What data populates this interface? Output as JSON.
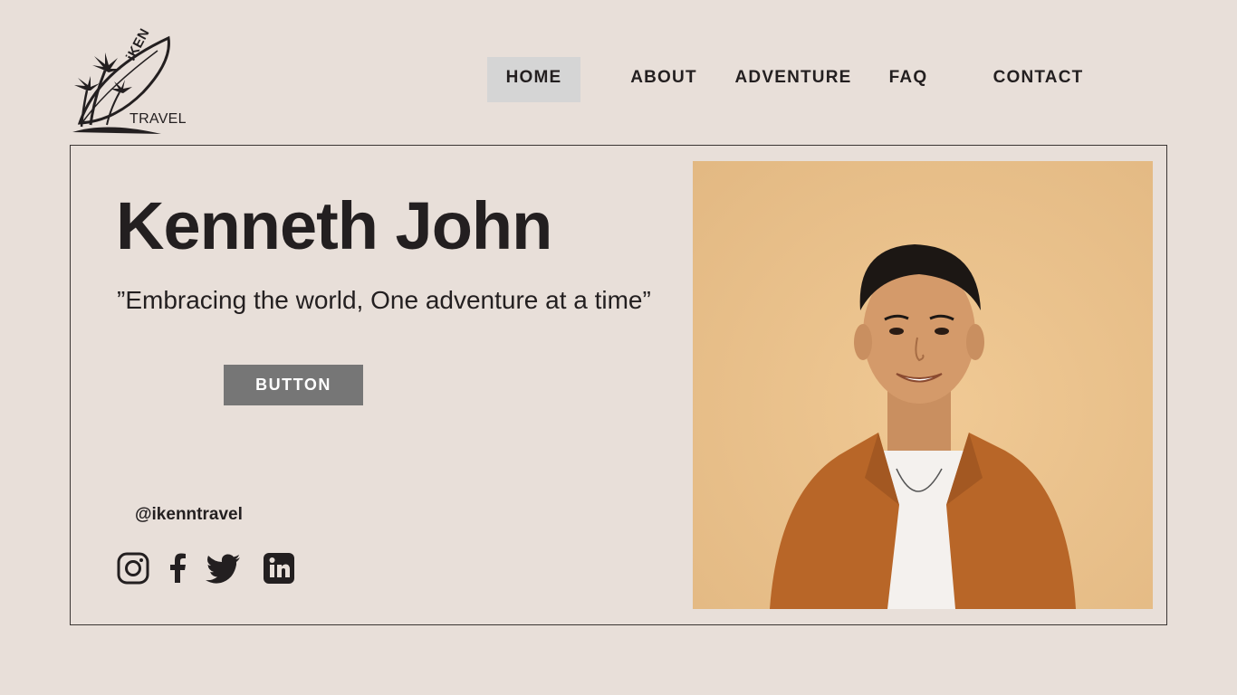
{
  "logo": {
    "ken": "iKEN",
    "travel": "TRAVEL"
  },
  "nav": {
    "items": [
      {
        "label": "HOME",
        "active": true
      },
      {
        "label": "ABOUT",
        "active": false
      },
      {
        "label": "ADVENTURE",
        "active": false
      },
      {
        "label": "FAQ",
        "active": false
      },
      {
        "label": "CONTACT",
        "active": false
      }
    ]
  },
  "hero": {
    "name": "Kenneth John",
    "quote": "”Embracing the world, One adventure at a time”",
    "button_label": "BUTTON",
    "handle": "@ikenntravel"
  },
  "socials": [
    {
      "icon": "instagram-icon"
    },
    {
      "icon": "facebook-icon"
    },
    {
      "icon": "twitter-icon"
    },
    {
      "icon": "linkedin-icon"
    }
  ],
  "colors": {
    "background": "#e8dfd9",
    "text": "#231f20",
    "nav_active": "#d5d5d5",
    "button": "#767676",
    "photo_background": "#eac592",
    "shirt": "#b86628"
  }
}
